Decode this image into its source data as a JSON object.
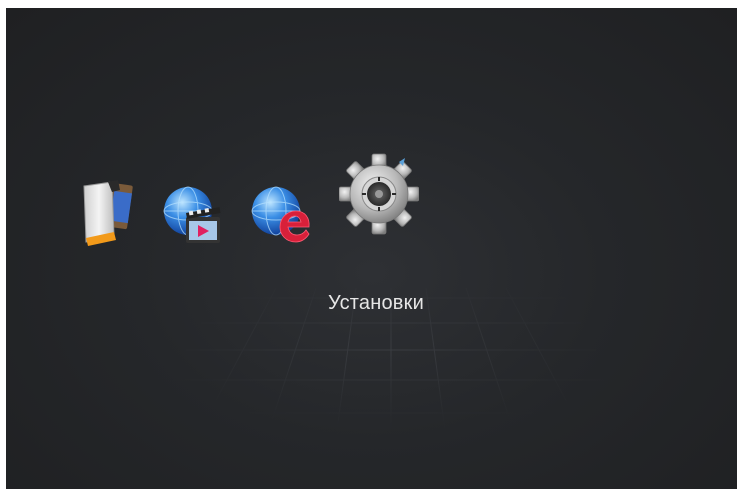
{
  "menu": {
    "items": [
      {
        "icon": "media-files-icon"
      },
      {
        "icon": "online-video-icon"
      },
      {
        "icon": "web-browser-icon"
      },
      {
        "icon": "settings-gear-icon",
        "selected": true
      }
    ],
    "selected_label": "Установки"
  },
  "colors": {
    "background": "#25272a",
    "label_text": "#e6e6e6",
    "accent_red": "#d8203a",
    "globe_blue": "#2a6fd0"
  }
}
